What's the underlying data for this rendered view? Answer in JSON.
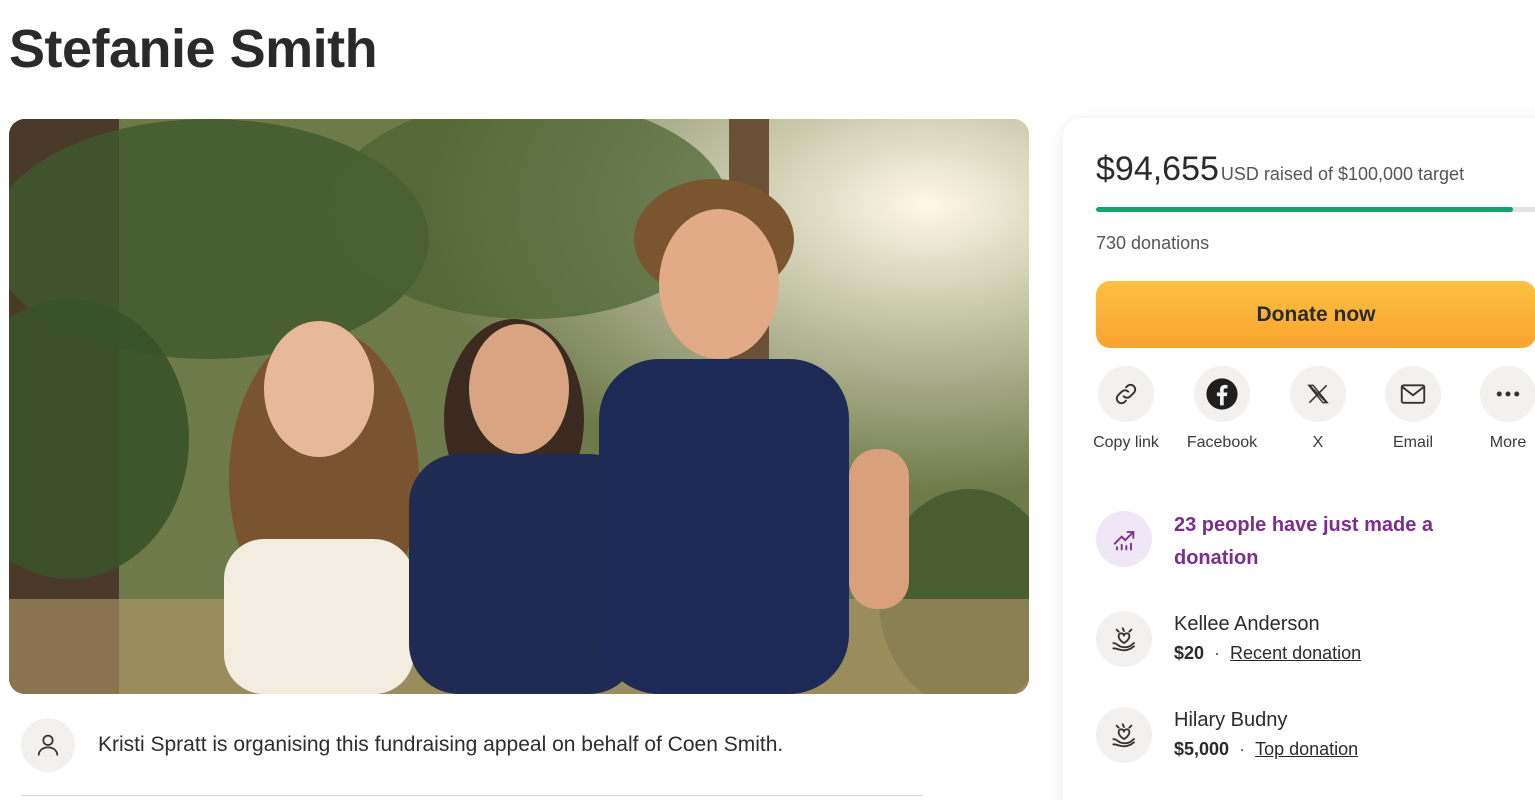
{
  "page": {
    "title": "Stefanie Smith"
  },
  "organiser": {
    "text": "Kristi Spratt is organising this fundraising appeal on behalf of Coen Smith."
  },
  "campaign": {
    "raised_amount": "$94,655",
    "currency": "USD",
    "raised_suffix": "raised of $100,000 target",
    "progress_fraction": 0.9466,
    "donations_count": "730 donations",
    "donate_label": "Donate now"
  },
  "share": [
    {
      "label": "Copy link",
      "icon": "link-icon"
    },
    {
      "label": "Facebook",
      "icon": "facebook-icon"
    },
    {
      "label": "X",
      "icon": "x-icon"
    },
    {
      "label": "Email",
      "icon": "mail-icon"
    },
    {
      "label": "More",
      "icon": "more-icon"
    }
  ],
  "trend": {
    "text": "23 people have just made a donation"
  },
  "donors": [
    {
      "name": "Kellee Anderson",
      "amount": "$20",
      "tag": "Recent donation"
    },
    {
      "name": "Hilary Budny",
      "amount": "$5,000",
      "tag": "Top donation"
    }
  ],
  "colors": {
    "progress": "#12a36a",
    "donate_button": "#f8a530",
    "trend_text": "#7b2d91"
  }
}
